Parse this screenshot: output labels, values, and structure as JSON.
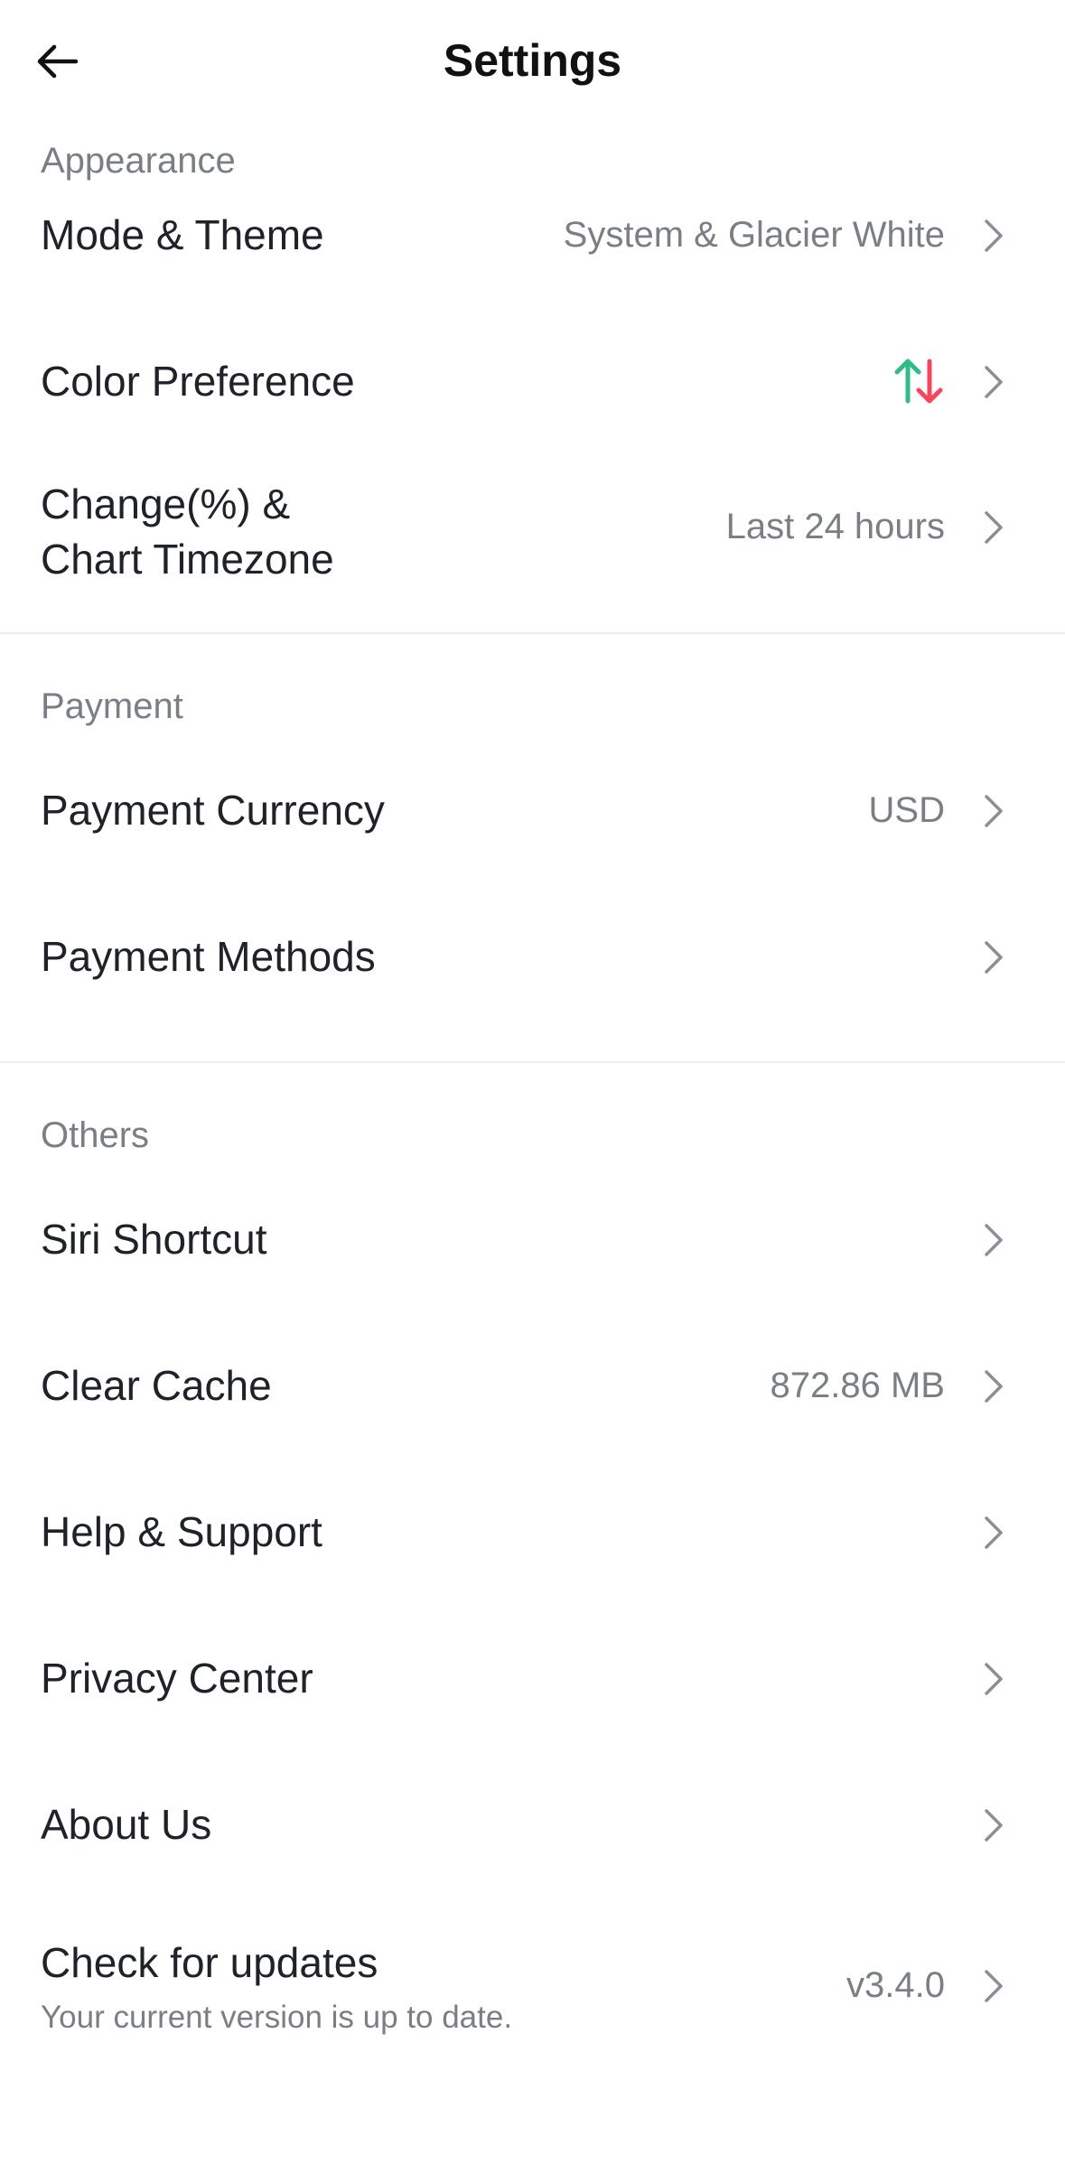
{
  "header": {
    "title": "Settings"
  },
  "sections": {
    "appearance": {
      "label": "Appearance",
      "mode_theme": {
        "label": "Mode & Theme",
        "value": "System & Glacier White"
      },
      "color_preference": {
        "label": "Color Preference",
        "up_color": "#2ebd85",
        "down_color": "#f6465d"
      },
      "change_timezone": {
        "label_line1": "Change(%) &",
        "label_line2": "Chart Timezone",
        "value": "Last 24 hours"
      }
    },
    "payment": {
      "label": "Payment",
      "currency": {
        "label": "Payment Currency",
        "value": "USD"
      },
      "methods": {
        "label": "Payment Methods"
      }
    },
    "others": {
      "label": "Others",
      "siri": {
        "label": "Siri Shortcut"
      },
      "cache": {
        "label": "Clear Cache",
        "value": "872.86 MB"
      },
      "help": {
        "label": "Help & Support"
      },
      "privacy": {
        "label": "Privacy Center"
      },
      "about": {
        "label": "About Us"
      },
      "updates": {
        "label": "Check for updates",
        "subtext": "Your current version is up to date.",
        "value": "v3.4.0"
      }
    }
  },
  "icons": {
    "back": "arrow-left-icon",
    "chevron": "chevron-right-icon",
    "color_pref": "up-down-arrows-icon"
  }
}
